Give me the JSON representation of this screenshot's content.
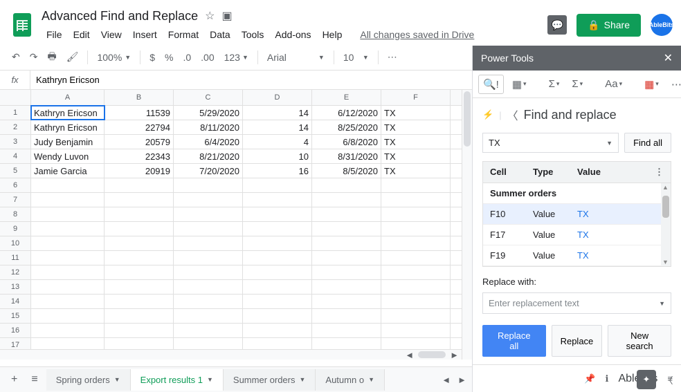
{
  "doc_title": "Advanced Find and Replace",
  "saved_text": "All changes saved in Drive",
  "share_label": "Share",
  "avatar_text": "AbleBits",
  "menu": [
    "File",
    "Edit",
    "View",
    "Insert",
    "Format",
    "Data",
    "Tools",
    "Add-ons",
    "Help"
  ],
  "toolbar": {
    "zoom": "100%",
    "font": "Arial",
    "size": "10",
    "currency": "$",
    "percent": "%",
    "dec_dec": ".0",
    "dec_inc": ".00",
    "num_fmt": "123"
  },
  "formula_value": "Kathryn Ericson",
  "columns": [
    "A",
    "B",
    "C",
    "D",
    "E",
    "F"
  ],
  "grid": [
    [
      "Kathryn Ericson",
      "11539",
      "5/29/2020",
      "14",
      "6/12/2020",
      "TX"
    ],
    [
      "Kathryn Ericson",
      "22794",
      "8/11/2020",
      "14",
      "8/25/2020",
      "TX"
    ],
    [
      "Judy Benjamin",
      "20579",
      "6/4/2020",
      "4",
      "6/8/2020",
      "TX"
    ],
    [
      "Wendy Luvon",
      "22343",
      "8/21/2020",
      "10",
      "8/31/2020",
      "TX"
    ],
    [
      "Jamie Garcia",
      "20919",
      "7/20/2020",
      "16",
      "8/5/2020",
      "TX"
    ]
  ],
  "sheets": [
    {
      "name": "Spring orders",
      "active": false
    },
    {
      "name": "Export results 1",
      "active": true
    },
    {
      "name": "Summer orders",
      "active": false
    },
    {
      "name": "Autumn o",
      "active": false
    }
  ],
  "sidebar": {
    "header": "Power Tools",
    "title": "Find and replace",
    "search_value": "TX",
    "find_all": "Find all",
    "headers": {
      "cell": "Cell",
      "type": "Type",
      "value": "Value"
    },
    "group": "Summer orders",
    "results": [
      {
        "cell": "F10",
        "type": "Value",
        "value": "TX",
        "selected": true
      },
      {
        "cell": "F17",
        "type": "Value",
        "value": "TX",
        "selected": false
      },
      {
        "cell": "F19",
        "type": "Value",
        "value": "TX",
        "selected": false
      }
    ],
    "replace_label": "Replace with:",
    "replace_placeholder": "Enter replacement text",
    "replace_all": "Replace all",
    "replace": "Replace",
    "new_search": "New search",
    "brand": "Ablebits"
  }
}
